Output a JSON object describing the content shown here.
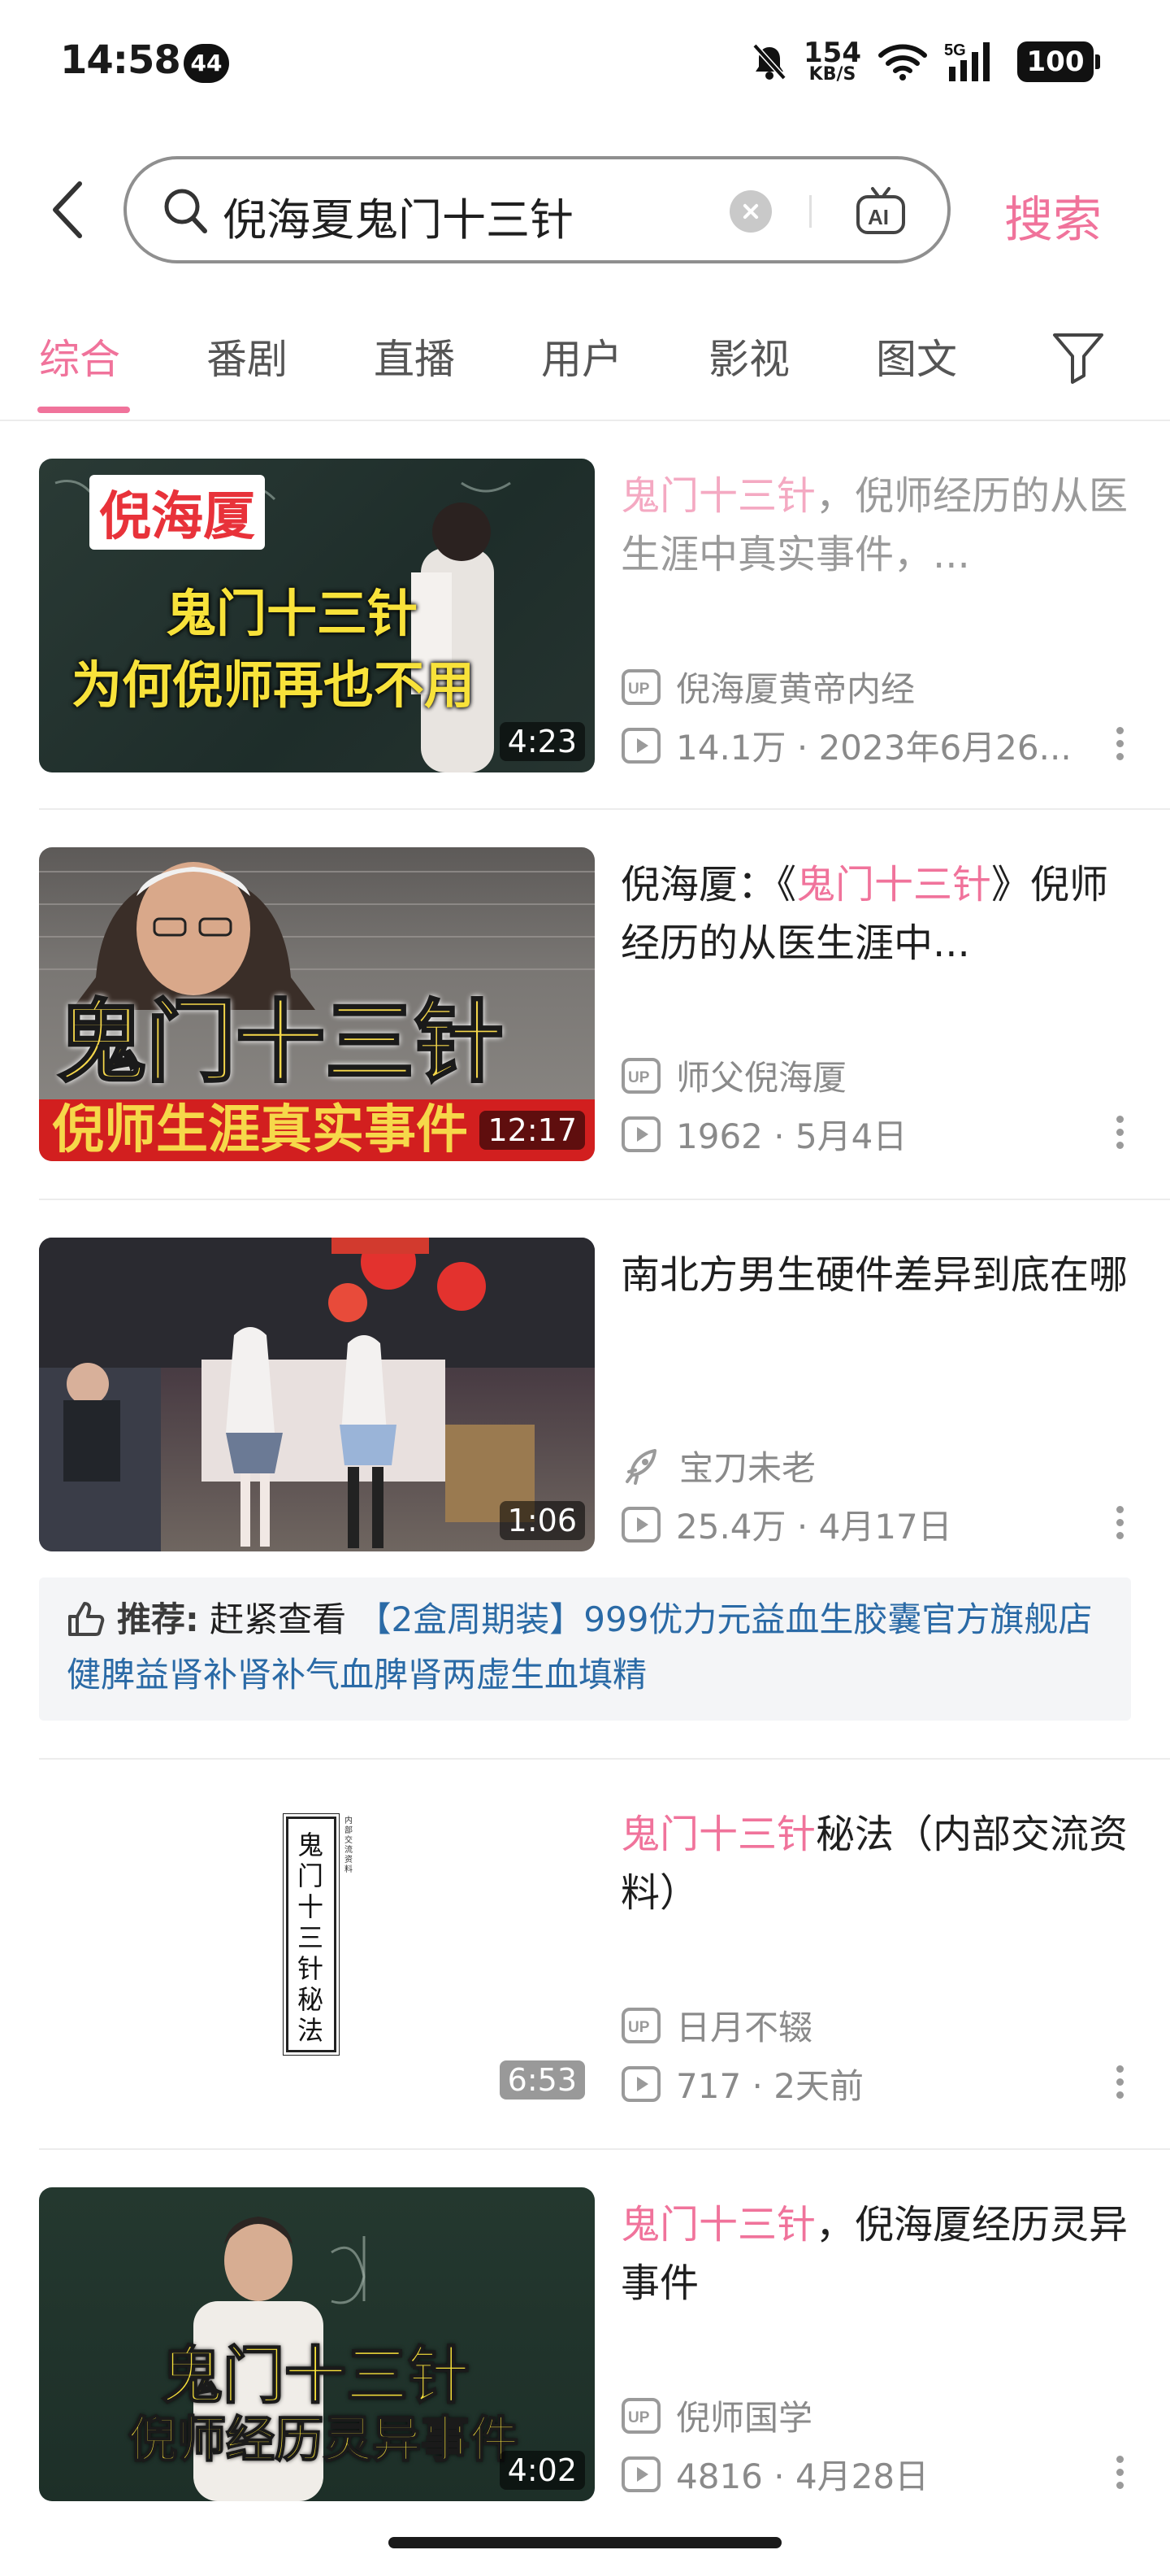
{
  "status_bar": {
    "time": "14:58",
    "notification_count": "44",
    "net_speed_value": "154",
    "net_speed_unit": "KB/S",
    "network_type": "5G",
    "battery": "100"
  },
  "search": {
    "query": "倪海夏鬼门十三针",
    "submit_label": "搜索"
  },
  "tabs": [
    {
      "label": "综合",
      "active": true
    },
    {
      "label": "番剧",
      "active": false
    },
    {
      "label": "直播",
      "active": false
    },
    {
      "label": "用户",
      "active": false
    },
    {
      "label": "影视",
      "active": false
    },
    {
      "label": "图文",
      "active": false
    }
  ],
  "results": [
    {
      "title_highlight": "鬼门十三针",
      "title_rest": "，倪师经历的从医生涯中真实事件，...",
      "author": "倪海厦黄帝内经",
      "author_type": "up",
      "stats": "14.1万 · 2023年6月26...",
      "duration": "4:23",
      "thumb_caption_1": "倪海厦",
      "thumb_caption_2": "鬼门十三针",
      "thumb_caption_3": "为何倪师再也不用"
    },
    {
      "title_pre": "倪海厦：《",
      "title_highlight": "鬼门十三针",
      "title_rest": "》倪师经历的从医生涯中...",
      "author": "师父倪海厦",
      "author_type": "up",
      "stats": "1962 · 5月4日",
      "duration": "12:17",
      "thumb_caption_1": "鬼门十三针",
      "thumb_caption_2": "倪师生涯真实事件"
    },
    {
      "title_rest": "南北方男生硬件差异到底在哪",
      "author": "宝刀未老",
      "author_type": "rocket",
      "stats": "25.4万 · 4月17日",
      "duration": "1:06"
    },
    {
      "title_highlight": "鬼门十三针",
      "title_rest": "秘法（内部交流资料）",
      "author": "日月不辍",
      "author_type": "up",
      "stats": "717 · 2天前",
      "duration": "6:53",
      "book_title": "鬼门十三针秘法",
      "book_side_note": "内部交流资料"
    },
    {
      "title_highlight": "鬼门十三针",
      "title_rest": "，倪海厦经历灵异事件",
      "author": "倪师国学",
      "author_type": "up",
      "stats": "4816 · 4月28日",
      "duration": "4:02",
      "thumb_caption_1": "鬼门十三针",
      "thumb_caption_2": "倪师经历灵异事件"
    }
  ],
  "ad": {
    "label": "推荐:",
    "lead": "赶紧查看",
    "link": "【2盒周期装】999优力元益血生胶囊官方旗舰店健脾益肾补肾补气血脾肾两虚生血填精"
  },
  "colors": {
    "accent": "#f0739b",
    "link": "#2a6aa6",
    "meta": "#8a8a8a"
  }
}
